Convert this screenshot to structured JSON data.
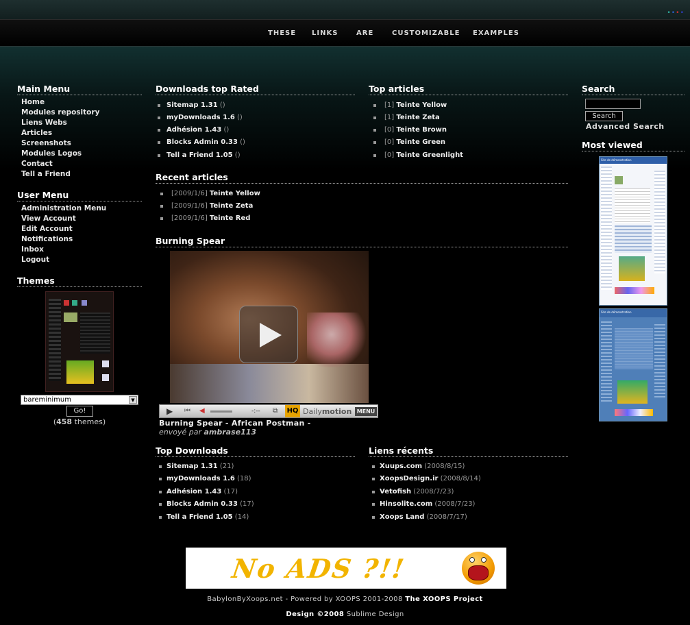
{
  "header": {
    "dots": [
      "•",
      "•",
      "•",
      "•"
    ],
    "dot_colors": [
      "#2fb6a4",
      "#2a62cf",
      "#d43030",
      "#2f3fc8"
    ]
  },
  "nav": [
    "THESE",
    "LINKS",
    "ARE",
    "CUSTOMIZABLE",
    "EXAMPLES"
  ],
  "main_menu": {
    "title": "Main Menu",
    "items": [
      "Home",
      "Modules repository",
      "Liens Webs",
      "Articles",
      "Screenshots",
      "Modules Logos",
      "Contact",
      "Tell a Friend"
    ]
  },
  "user_menu": {
    "title": "User Menu",
    "items": [
      "Administration Menu",
      "View Account",
      "Edit Account",
      "Notifications",
      "Inbox",
      "Logout"
    ]
  },
  "themes": {
    "title": "Themes",
    "selected": "bareminimum",
    "go": "Go!",
    "count": "458",
    "suffix": "themes"
  },
  "downloads_top": {
    "title": "Downloads top Rated",
    "items": [
      {
        "name": "Sitemap 1.31",
        "extra": "()"
      },
      {
        "name": "myDownloads 1.6",
        "extra": "()"
      },
      {
        "name": "Adhésion 1.43",
        "extra": "()"
      },
      {
        "name": "Blocks Admin 0.33",
        "extra": "()"
      },
      {
        "name": "Tell a Friend 1.05",
        "extra": "()"
      }
    ]
  },
  "top_articles": {
    "title": "Top articles",
    "items": [
      {
        "prefix": "[1]",
        "name": "Teinte Yellow"
      },
      {
        "prefix": "[1]",
        "name": "Teinte Zeta"
      },
      {
        "prefix": "[0]",
        "name": "Teinte Brown"
      },
      {
        "prefix": "[0]",
        "name": "Teinte Green"
      },
      {
        "prefix": "[0]",
        "name": "Teinte Greenlight"
      }
    ]
  },
  "recent_articles": {
    "title": "Recent articles",
    "items": [
      {
        "prefix": "[2009/1/6]",
        "name": "Teinte Yellow"
      },
      {
        "prefix": "[2009/1/6]",
        "name": "Teinte Zeta"
      },
      {
        "prefix": "[2009/1/6]",
        "name": "Teinte Red"
      }
    ]
  },
  "video": {
    "title": "Burning Spear",
    "caption": "Burning Spear - African Postman -",
    "by_label": "envoyé par",
    "author": "ambrase113",
    "time": "-:--",
    "hq": "HQ",
    "brand": "Daily",
    "brand2": "motion",
    "menu": "MENU"
  },
  "top_downloads": {
    "title": "Top Downloads",
    "items": [
      {
        "name": "Sitemap 1.31",
        "extra": "(21)"
      },
      {
        "name": "myDownloads 1.6",
        "extra": "(18)"
      },
      {
        "name": "Adhésion 1.43",
        "extra": "(17)"
      },
      {
        "name": "Blocks Admin 0.33",
        "extra": "(17)"
      },
      {
        "name": "Tell a Friend 1.05",
        "extra": "(14)"
      }
    ]
  },
  "liens": {
    "title": "Liens récents",
    "items": [
      {
        "name": "Xuups.com",
        "extra": "(2008/8/15)"
      },
      {
        "name": "XoopsDesign.ir",
        "extra": "(2008/8/14)"
      },
      {
        "name": "Vetofish",
        "extra": "(2008/7/23)"
      },
      {
        "name": "Hinsolite.com",
        "extra": "(2008/7/23)"
      },
      {
        "name": "Xoops Land",
        "extra": "(2008/7/17)"
      }
    ]
  },
  "search": {
    "title": "Search",
    "button": "Search",
    "advanced": "Advanced Search",
    "value": ""
  },
  "most_viewed": {
    "title": "Most viewed",
    "shot1": "Site de démonstration",
    "shot2": "Site de démonstration"
  },
  "ad": {
    "text": "No ADS ?!!"
  },
  "footer": {
    "line1_pre": "BabylonByXoops.net - Powered by XOOPS 2001-2008",
    "line1_link": "The XOOPS Project",
    "line2_link": "Design ©2008",
    "line2_post": "Sublime Design"
  }
}
